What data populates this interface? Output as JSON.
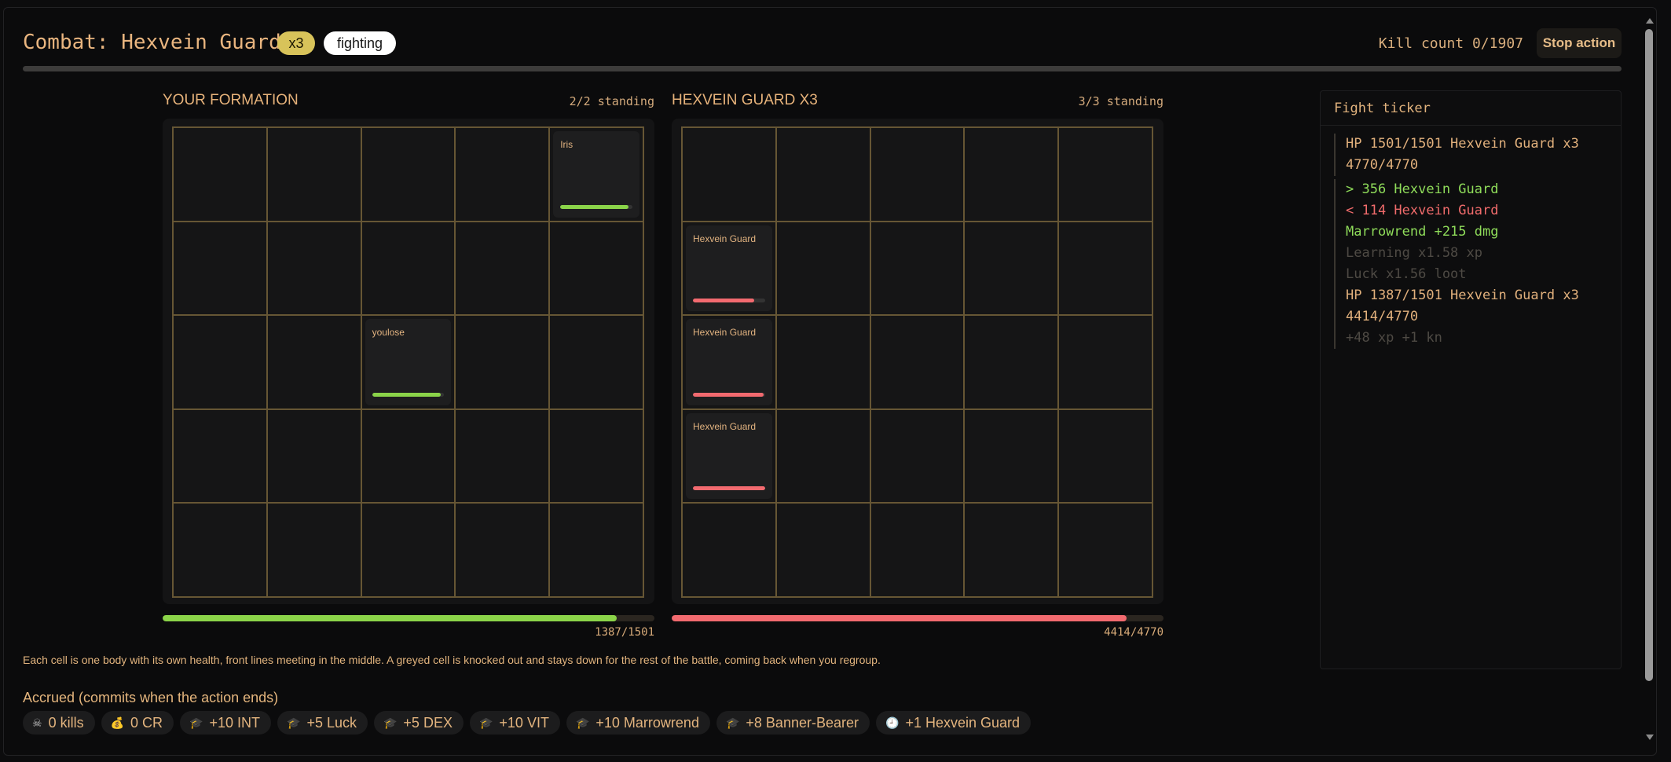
{
  "header": {
    "title": "Combat: Hexvein Guard",
    "count_pill": "x3",
    "state_pill": "fighting",
    "kill_count": "Kill count 0/1907",
    "stop_label": "Stop action",
    "top_progress_fraction": 1.0
  },
  "formation": {
    "label": "YOUR FORMATION",
    "standing": "2/2 standing",
    "total_hp": "1387/1501",
    "total_fraction": 0.924,
    "units": [
      {
        "name": "Iris",
        "row": 0,
        "col": 4,
        "hp_fraction": 0.95,
        "side": "ally"
      },
      {
        "name": "youlose",
        "row": 2,
        "col": 2,
        "hp_fraction": 0.95,
        "side": "ally"
      }
    ]
  },
  "enemy": {
    "label": "HEXVEIN GUARD X3",
    "standing": "3/3 standing",
    "total_hp": "4414/4770",
    "total_fraction": 0.925,
    "units": [
      {
        "name": "Hexvein Guard",
        "row": 1,
        "col": 0,
        "hp_fraction": 0.85,
        "side": "enemy"
      },
      {
        "name": "Hexvein Guard",
        "row": 2,
        "col": 0,
        "hp_fraction": 0.98,
        "side": "enemy"
      },
      {
        "name": "Hexvein Guard",
        "row": 3,
        "col": 0,
        "hp_fraction": 1.0,
        "side": "enemy"
      }
    ]
  },
  "ticker": {
    "title": "Fight ticker",
    "group1": [
      {
        "text": "HP 1501/1501 Hexvein Guard x3",
        "tone": "amber"
      },
      {
        "text": "4770/4770",
        "tone": "amber"
      }
    ],
    "group2": [
      {
        "text": "> 356 Hexvein Guard",
        "tone": "green"
      },
      {
        "text": "< 114 Hexvein Guard",
        "tone": "red"
      },
      {
        "text": "Marrowrend +215 dmg",
        "tone": "green"
      },
      {
        "text": "Learning x1.58 xp",
        "tone": "dim"
      },
      {
        "text": "Luck x1.56 loot",
        "tone": "dim"
      },
      {
        "text": "HP 1387/1501 Hexvein Guard x3",
        "tone": "amber"
      },
      {
        "text": "4414/4770",
        "tone": "amber"
      },
      {
        "text": "+48 xp +1 kn",
        "tone": "dim"
      }
    ]
  },
  "note": "Each cell is one body with its own health, front lines meeting in the middle. A greyed cell is knocked out and stays down for the rest of the battle, coming back when you regroup.",
  "accrued": {
    "title": "Accrued (commits when the action ends)",
    "chips": [
      {
        "icon": "skull-icon",
        "glyph": "☠",
        "label": "0 kills"
      },
      {
        "icon": "coin-bag-icon",
        "glyph": "💰",
        "label": "0 CR"
      },
      {
        "icon": "graduation-cap-icon",
        "glyph": "🎓",
        "label": "+10 INT"
      },
      {
        "icon": "graduation-cap-icon",
        "glyph": "🎓",
        "label": "+5 Luck"
      },
      {
        "icon": "graduation-cap-icon",
        "glyph": "🎓",
        "label": "+5 DEX"
      },
      {
        "icon": "graduation-cap-icon",
        "glyph": "🎓",
        "label": "+10 VIT"
      },
      {
        "icon": "graduation-cap-icon",
        "glyph": "🎓",
        "label": "+10 Marrowrend"
      },
      {
        "icon": "graduation-cap-icon",
        "glyph": "🎓",
        "label": "+8 Banner-Bearer"
      },
      {
        "icon": "clock-icon",
        "glyph": "🕘",
        "label": "+1 Hexvein Guard"
      }
    ]
  },
  "colors": {
    "ally_hp": "#8bd449",
    "enemy_hp": "#f26a6f",
    "grid_line": "#665634",
    "accent_text": "#e6b27a"
  }
}
